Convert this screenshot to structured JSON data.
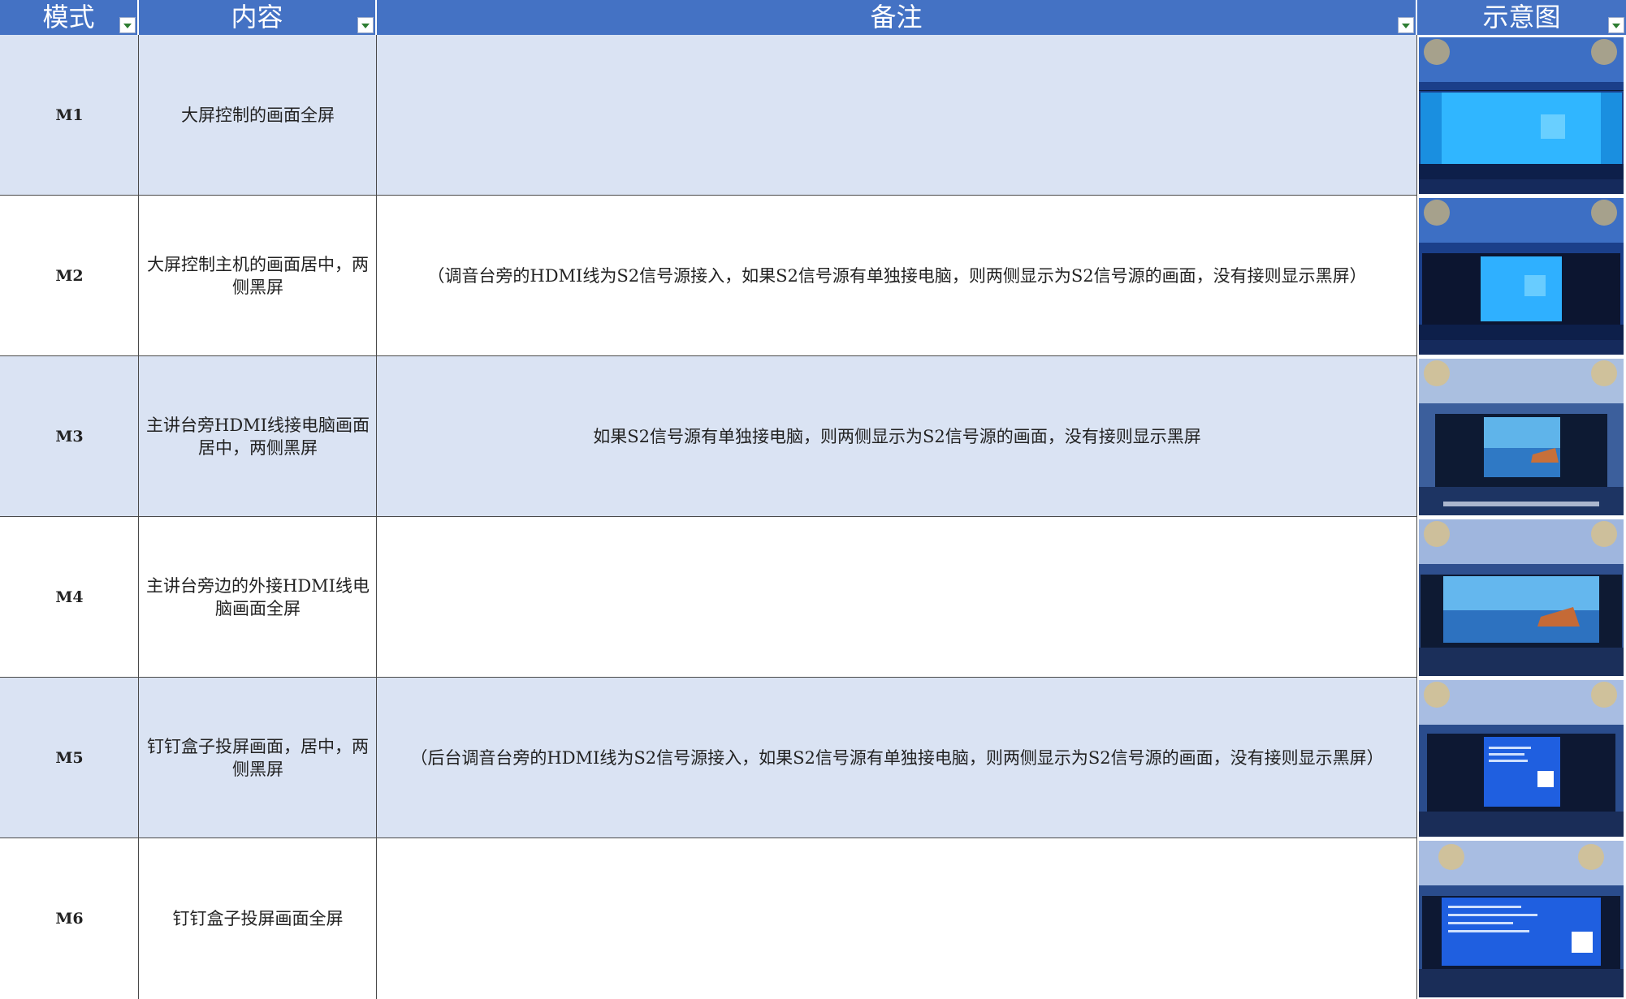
{
  "header": {
    "mode": "模式",
    "content": "内容",
    "note": "备注",
    "diagram": "示意图"
  },
  "rows": [
    {
      "mode": "M1",
      "content": "大屏控制的画面全屏",
      "note": "",
      "image": "full-blue-windows"
    },
    {
      "mode": "M2",
      "content": "大屏控制主机的画面居中，两侧黑屏",
      "note": "（调音台旁的HDMI线为S2信号源接入，如果S2信号源有单独接电脑，则两侧显示为S2信号源的画面，没有接则显示黑屏）",
      "image": "center-blue-windows"
    },
    {
      "mode": "M3",
      "content": "主讲台旁HDMI线接电脑画面居中，两侧黑屏",
      "note": "如果S2信号源有单独接电脑，则两侧显示为S2信号源的画面，没有接则显示黑屏",
      "image": "center-landscape"
    },
    {
      "mode": "M4",
      "content": "主讲台旁边的外接HDMI线电脑画面全屏",
      "note": "",
      "image": "full-landscape"
    },
    {
      "mode": "M5",
      "content": "钉钉盒子投屏画面，居中，两侧黑屏",
      "note": "（后台调音台旁的HDMI线为S2信号源接入，如果S2信号源有单独接电脑，则两侧显示为S2信号源的画面，没有接则显示黑屏）",
      "image": "center-slide"
    },
    {
      "mode": "M6",
      "content": "钉钉盒子投屏画面全屏",
      "note": "",
      "image": "full-slide"
    }
  ],
  "colors": {
    "header_bg": "#4472c4",
    "band_bg": "#dae3f3",
    "filter_arrow": "#2e7d32"
  }
}
